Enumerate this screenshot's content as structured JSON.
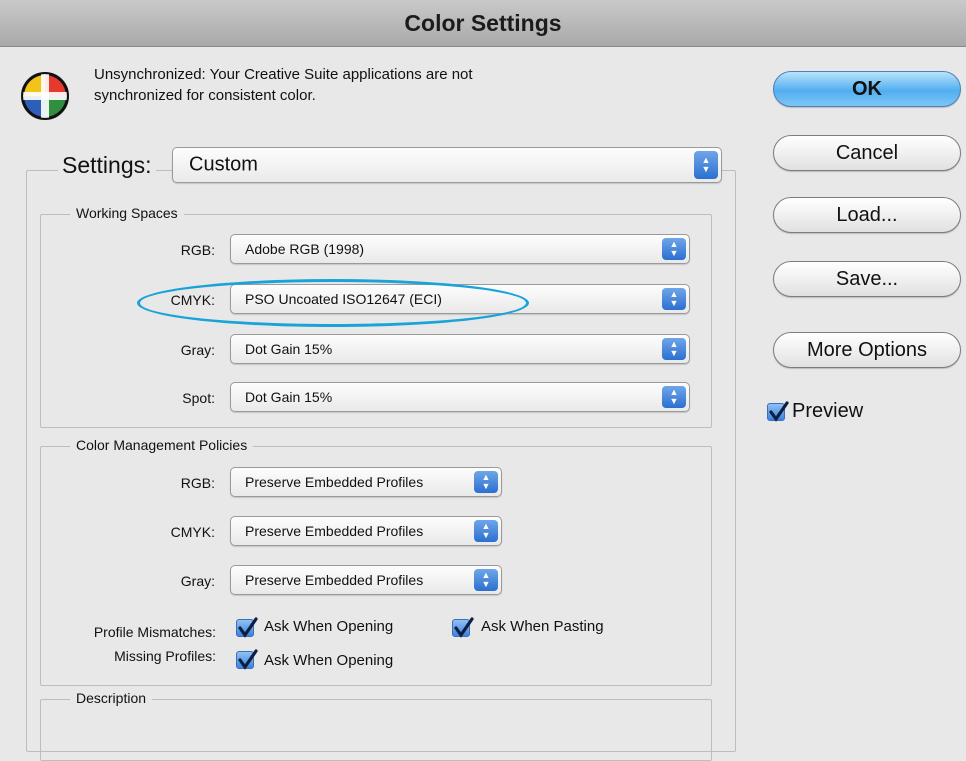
{
  "window": {
    "title": "Color Settings"
  },
  "sync": {
    "icon": "color-wheel-icon",
    "line1": "Unsynchronized: Your Creative Suite applications are not",
    "line2": "synchronized for consistent color."
  },
  "settings": {
    "label": "Settings:",
    "value": "Custom"
  },
  "working_spaces": {
    "title": "Working Spaces",
    "rows": [
      {
        "label": "RGB:",
        "value": "Adobe RGB (1998)"
      },
      {
        "label": "CMYK:",
        "value": "PSO Uncoated ISO12647 (ECI)"
      },
      {
        "label": "Gray:",
        "value": "Dot Gain 15%"
      },
      {
        "label": "Spot:",
        "value": "Dot Gain 15%"
      }
    ]
  },
  "policies": {
    "title": "Color Management Policies",
    "rows": [
      {
        "label": "RGB:",
        "value": "Preserve Embedded Profiles"
      },
      {
        "label": "CMYK:",
        "value": "Preserve Embedded Profiles"
      },
      {
        "label": "Gray:",
        "value": "Preserve Embedded Profiles"
      }
    ],
    "profile_mismatches": {
      "label": "Profile Mismatches:",
      "opening": "Ask When Opening",
      "pasting": "Ask When Pasting"
    },
    "missing_profiles": {
      "label": "Missing Profiles:",
      "opening": "Ask When Opening"
    }
  },
  "description": {
    "title": "Description"
  },
  "buttons": {
    "ok": "OK",
    "cancel": "Cancel",
    "load": "Load...",
    "save": "Save...",
    "more_options": "More Options"
  },
  "preview": {
    "label": "Preview",
    "checked": true
  },
  "colors": {
    "accent": "#3f82dc",
    "highlight_ellipse": "#1aa3d9"
  }
}
